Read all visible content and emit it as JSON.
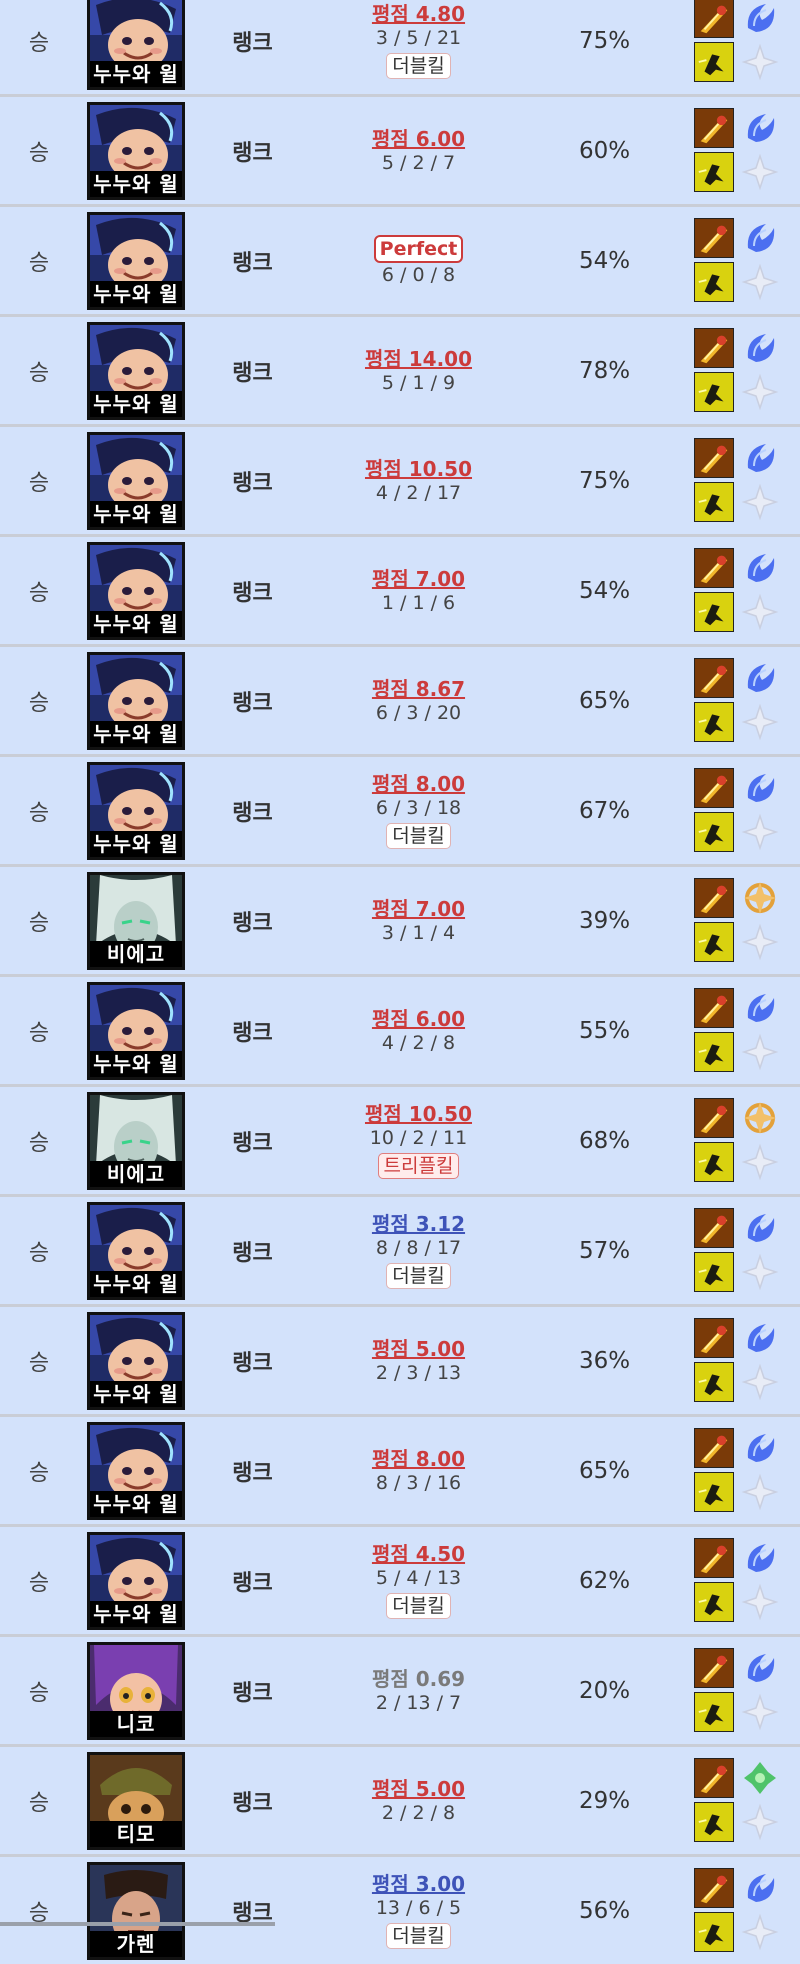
{
  "columns_hint": [
    "result",
    "champion",
    "queue",
    "score_kda",
    "kill_participation",
    "build"
  ],
  "matches": [
    {
      "result": "승",
      "champion": "누누와 윌",
      "queue": "랭크",
      "score": "평점 4.80",
      "score_style": "red",
      "kda": "3 / 5 / 21",
      "badge": "더블킬",
      "badge_style": "normal",
      "kp": "75%",
      "spell1": "ignite-icon",
      "spell2": "ghost-icon",
      "rune1": "blue-rune-icon",
      "rune2": "white-shard-icon"
    },
    {
      "result": "승",
      "champion": "누누와 윌",
      "queue": "랭크",
      "score": "평점 6.00",
      "score_style": "red",
      "kda": "5 / 2 / 7",
      "badge": "",
      "badge_style": "",
      "kp": "60%",
      "spell1": "ignite-icon",
      "spell2": "ghost-icon",
      "rune1": "blue-rune-icon",
      "rune2": "white-shard-icon"
    },
    {
      "result": "승",
      "champion": "누누와 윌",
      "queue": "랭크",
      "score": "Perfect",
      "score_style": "perfect",
      "kda": "6 / 0 / 8",
      "badge": "",
      "badge_style": "",
      "kp": "54%",
      "spell1": "ignite-icon",
      "spell2": "ghost-icon",
      "rune1": "blue-rune-icon",
      "rune2": "white-shard-icon"
    },
    {
      "result": "승",
      "champion": "누누와 윌",
      "queue": "랭크",
      "score": "평점 14.00",
      "score_style": "red",
      "kda": "5 / 1 / 9",
      "badge": "",
      "badge_style": "",
      "kp": "78%",
      "spell1": "ignite-icon",
      "spell2": "ghost-icon",
      "rune1": "blue-rune-icon",
      "rune2": "white-shard-icon"
    },
    {
      "result": "승",
      "champion": "누누와 윌",
      "queue": "랭크",
      "score": "평점 10.50",
      "score_style": "red",
      "kda": "4 / 2 / 17",
      "badge": "",
      "badge_style": "",
      "kp": "75%",
      "spell1": "ignite-icon",
      "spell2": "ghost-icon",
      "rune1": "blue-rune-icon",
      "rune2": "white-shard-icon"
    },
    {
      "result": "승",
      "champion": "누누와 윌",
      "queue": "랭크",
      "score": "평점 7.00",
      "score_style": "red",
      "kda": "1 / 1 / 6",
      "badge": "",
      "badge_style": "",
      "kp": "54%",
      "spell1": "ignite-icon",
      "spell2": "ghost-icon",
      "rune1": "blue-rune-icon",
      "rune2": "white-shard-icon"
    },
    {
      "result": "승",
      "champion": "누누와 윌",
      "queue": "랭크",
      "score": "평점 8.67",
      "score_style": "red",
      "kda": "6 / 3 / 20",
      "badge": "",
      "badge_style": "",
      "kp": "65%",
      "spell1": "ignite-icon",
      "spell2": "ghost-icon",
      "rune1": "blue-rune-icon",
      "rune2": "white-shard-icon"
    },
    {
      "result": "승",
      "champion": "누누와 윌",
      "queue": "랭크",
      "score": "평점 8.00",
      "score_style": "red",
      "kda": "6 / 3 / 18",
      "badge": "더블킬",
      "badge_style": "normal",
      "kp": "67%",
      "spell1": "ignite-icon",
      "spell2": "ghost-icon",
      "rune1": "blue-rune-icon",
      "rune2": "white-shard-icon"
    },
    {
      "result": "승",
      "champion": "비에고",
      "queue": "랭크",
      "score": "평점 7.00",
      "score_style": "red",
      "kda": "3 / 1 / 4",
      "badge": "",
      "badge_style": "",
      "kp": "39%",
      "spell1": "ignite-icon",
      "spell2": "ghost-icon",
      "rune1": "orange-rune-icon",
      "rune2": "white-shard-icon"
    },
    {
      "result": "승",
      "champion": "누누와 윌",
      "queue": "랭크",
      "score": "평점 6.00",
      "score_style": "red",
      "kda": "4 / 2 / 8",
      "badge": "",
      "badge_style": "",
      "kp": "55%",
      "spell1": "ignite-icon",
      "spell2": "ghost-icon",
      "rune1": "blue-rune-icon",
      "rune2": "white-shard-icon"
    },
    {
      "result": "승",
      "champion": "비에고",
      "queue": "랭크",
      "score": "평점 10.50",
      "score_style": "red",
      "kda": "10 / 2 / 11",
      "badge": "트리플킬",
      "badge_style": "triple",
      "kp": "68%",
      "spell1": "ignite-icon",
      "spell2": "ghost-icon",
      "rune1": "orange-rune-icon",
      "rune2": "white-shard-icon"
    },
    {
      "result": "승",
      "champion": "누누와 윌",
      "queue": "랭크",
      "score": "평점 3.12",
      "score_style": "blue",
      "kda": "8 / 8 / 17",
      "badge": "더블킬",
      "badge_style": "normal",
      "kp": "57%",
      "spell1": "ignite-icon",
      "spell2": "ghost-icon",
      "rune1": "blue-rune-icon",
      "rune2": "white-shard-icon"
    },
    {
      "result": "승",
      "champion": "누누와 윌",
      "queue": "랭크",
      "score": "평점 5.00",
      "score_style": "red",
      "kda": "2 / 3 / 13",
      "badge": "",
      "badge_style": "",
      "kp": "36%",
      "spell1": "ignite-icon",
      "spell2": "ghost-icon",
      "rune1": "blue-rune-icon",
      "rune2": "white-shard-icon"
    },
    {
      "result": "승",
      "champion": "누누와 윌",
      "queue": "랭크",
      "score": "평점 8.00",
      "score_style": "red",
      "kda": "8 / 3 / 16",
      "badge": "",
      "badge_style": "",
      "kp": "65%",
      "spell1": "ignite-icon",
      "spell2": "ghost-icon",
      "rune1": "blue-rune-icon",
      "rune2": "white-shard-icon"
    },
    {
      "result": "승",
      "champion": "누누와 윌",
      "queue": "랭크",
      "score": "평점 4.50",
      "score_style": "red",
      "kda": "5 / 4 / 13",
      "badge": "더블킬",
      "badge_style": "normal",
      "kp": "62%",
      "spell1": "ignite-icon",
      "spell2": "ghost-icon",
      "rune1": "blue-rune-icon",
      "rune2": "white-shard-icon"
    },
    {
      "result": "승",
      "champion": "니코",
      "queue": "랭크",
      "score": "평점 0.69",
      "score_style": "gray",
      "kda": "2 / 13 / 7",
      "badge": "",
      "badge_style": "",
      "kp": "20%",
      "spell1": "ignite-icon",
      "spell2": "ghost-icon",
      "rune1": "blue-rune-icon",
      "rune2": "white-shard-icon"
    },
    {
      "result": "승",
      "champion": "티모",
      "queue": "랭크",
      "score": "평점 5.00",
      "score_style": "red",
      "kda": "2 / 2 / 8",
      "badge": "",
      "badge_style": "",
      "kp": "29%",
      "spell1": "ignite-icon",
      "spell2": "ghost-icon",
      "rune1": "green-rune-icon",
      "rune2": "white-shard-icon"
    },
    {
      "result": "승",
      "champion": "가렌",
      "queue": "랭크",
      "score": "평점 3.00",
      "score_style": "blue",
      "kda": "13 / 6 / 5",
      "badge": "더블킬",
      "badge_style": "normal",
      "kp": "56%",
      "spell1": "ignite-icon",
      "spell2": "ghost-icon",
      "rune1": "blue-rune-icon",
      "rune2": "white-shard-icon"
    }
  ],
  "colors": {
    "row_bg": "#d3e2fb",
    "divider": "#c9cdd6",
    "score_red": "#cc3b3b",
    "score_blue": "#3e53b8",
    "score_gray": "#7a7a7a"
  }
}
